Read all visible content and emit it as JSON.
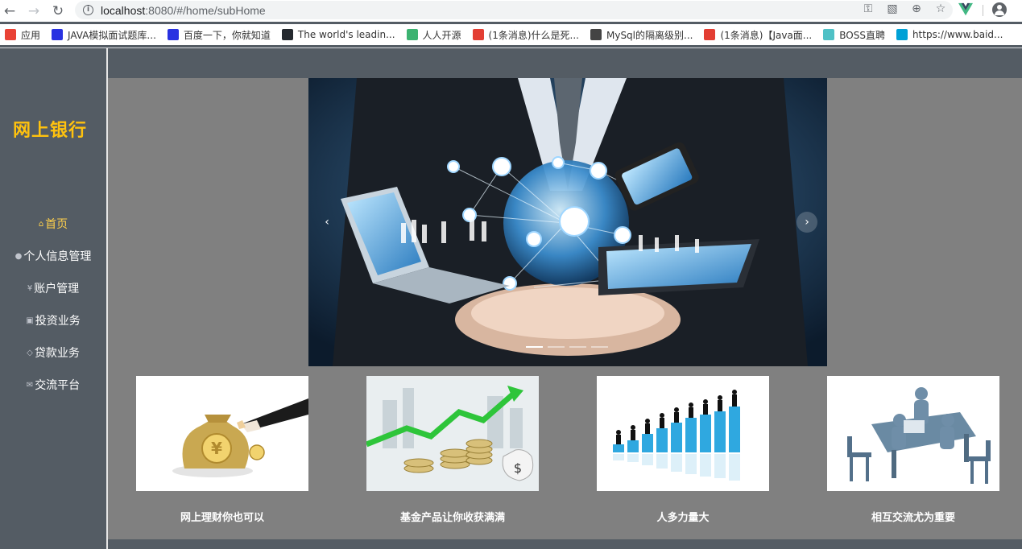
{
  "browser": {
    "url_host": "localhost",
    "url_rest": ":8080/#/home/subHome",
    "bookmarks": [
      {
        "label": "应用",
        "icon": "apps-grid-icon",
        "color": "#e94235"
      },
      {
        "label": "JAVA模拟面试题库...",
        "icon": "baidu-paw-icon",
        "color": "#2932e1"
      },
      {
        "label": "百度一下，你就知道",
        "icon": "baidu-paw-icon",
        "color": "#2932e1"
      },
      {
        "label": "The world's leadin...",
        "icon": "github-icon",
        "color": "#24292e"
      },
      {
        "label": "人人开源",
        "icon": "renren-icon",
        "color": "#3cb371"
      },
      {
        "label": "(1条消息)什么是死...",
        "icon": "csdn-icon",
        "color": "#e33e33"
      },
      {
        "label": "MySql的隔离级别...",
        "icon": "bookmark-logo-icon",
        "color": "#444444"
      },
      {
        "label": "(1条消息)【Java面...",
        "icon": "csdn-icon",
        "color": "#e33e33"
      },
      {
        "label": "BOSS直聘",
        "icon": "boss-icon",
        "color": "#4fc1c6"
      },
      {
        "label": "https://www.baid...",
        "icon": "bilibili-tv-icon",
        "color": "#00a1d6"
      }
    ]
  },
  "sidebar": {
    "logo": "网上银行",
    "items": [
      {
        "label": "首页",
        "icon": "home-icon",
        "glyph": "⌂",
        "active": true
      },
      {
        "label": "个人信息管理",
        "icon": "user-icon",
        "glyph": "●",
        "active": false
      },
      {
        "label": "账户管理",
        "icon": "yen-icon",
        "glyph": "¥",
        "active": false
      },
      {
        "label": "投资业务",
        "icon": "money-icon",
        "glyph": "▣",
        "active": false
      },
      {
        "label": "贷款业务",
        "icon": "view-icon",
        "glyph": "◇",
        "active": false
      },
      {
        "label": "交流平台",
        "icon": "message-icon",
        "glyph": "✉",
        "active": false
      }
    ]
  },
  "carousel": {
    "prev": "‹",
    "next": "›",
    "slide_count": 4,
    "active_index": 0
  },
  "cards": [
    {
      "caption": "网上理财你也可以",
      "image": "money-bag-image"
    },
    {
      "caption": "基金产品让你收获满满",
      "image": "coins-growth-image"
    },
    {
      "caption": "人多力量大",
      "image": "bar-chart-people-image"
    },
    {
      "caption": "相互交流尤为重要",
      "image": "meeting-image"
    }
  ],
  "colors": {
    "sidebar_bg": "#545c64",
    "active_menu": "#ffd04b",
    "logo": "#ffc20e",
    "content_bg": "#808080"
  }
}
